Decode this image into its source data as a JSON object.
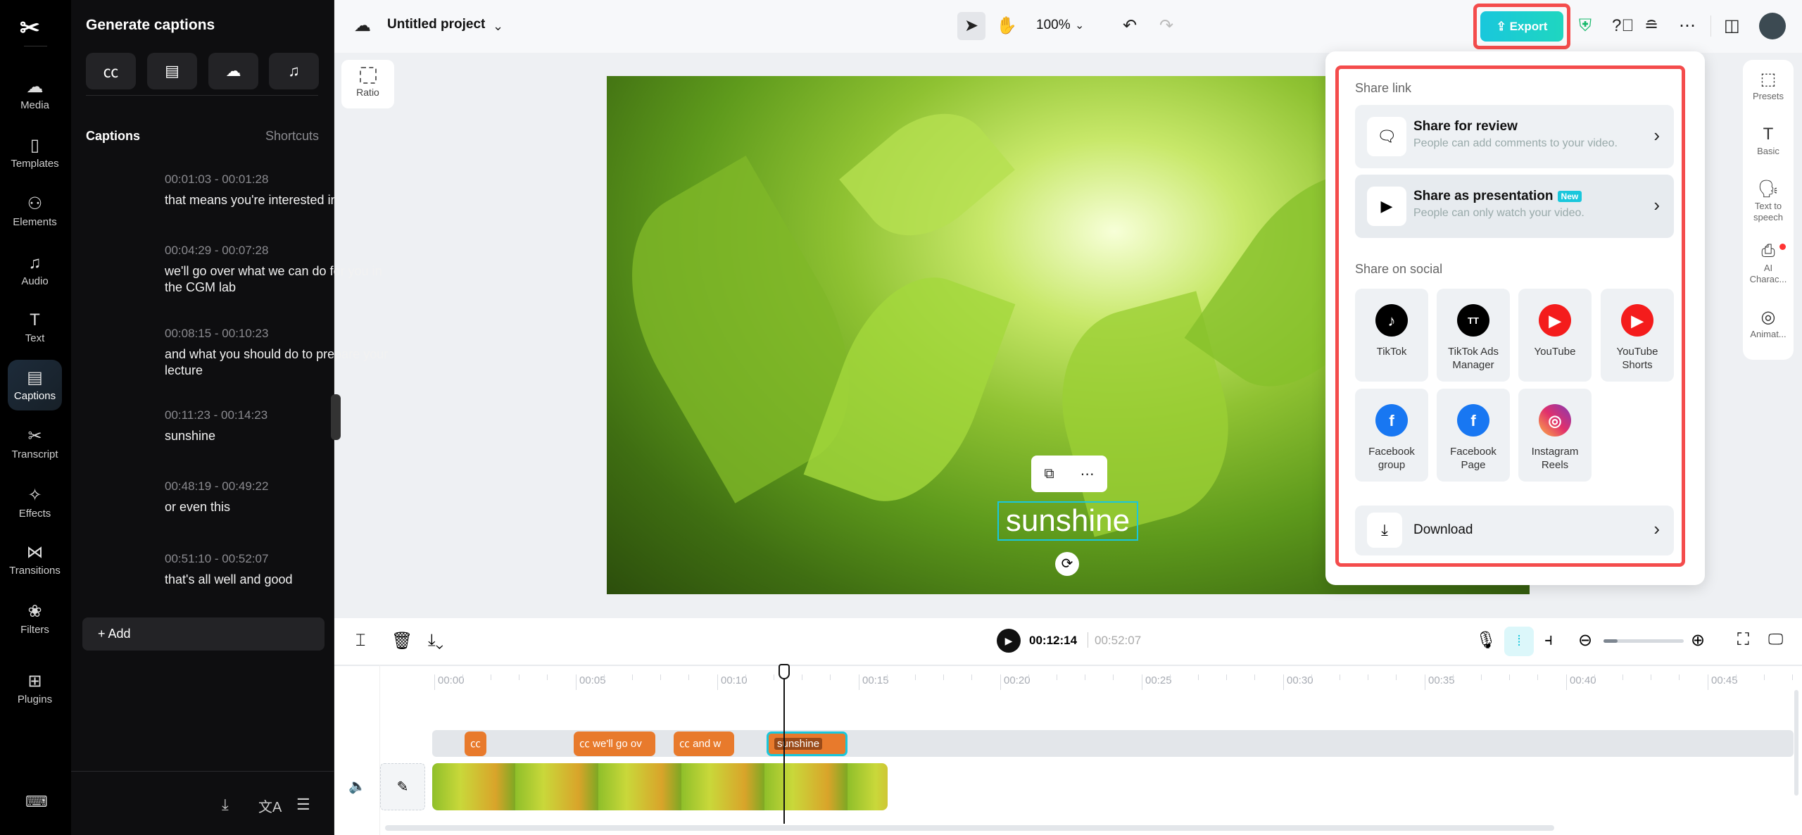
{
  "nav": {
    "items": [
      {
        "label": "Media",
        "icon": "cloud-upload-icon"
      },
      {
        "label": "Templates",
        "icon": "templates-icon"
      },
      {
        "label": "Elements",
        "icon": "elements-icon"
      },
      {
        "label": "Audio",
        "icon": "music-icon"
      },
      {
        "label": "Text",
        "icon": "text-icon"
      },
      {
        "label": "Captions",
        "icon": "captions-icon",
        "active": true
      },
      {
        "label": "Transcript",
        "icon": "transcript-icon"
      },
      {
        "label": "Effects",
        "icon": "effects-icon"
      },
      {
        "label": "Transitions",
        "icon": "transitions-icon"
      },
      {
        "label": "Filters",
        "icon": "filters-icon"
      },
      {
        "label": "Plugins",
        "icon": "plugins-icon"
      }
    ]
  },
  "captions_panel": {
    "title": "Generate captions",
    "section": "Captions",
    "shortcuts": "Shortcuts",
    "add": "+ Add",
    "items": [
      {
        "time": "00:01:03 - 00:01:28",
        "text": "that means you're interested in"
      },
      {
        "time": "00:04:29 - 00:07:28",
        "text": "we'll go over what we can do for you in the CGM lab"
      },
      {
        "time": "00:08:15 - 00:10:23",
        "text": "and what you should do to prepare your lecture"
      },
      {
        "time": "00:11:23 - 00:14:23",
        "text": "sunshine"
      },
      {
        "time": "00:48:19 - 00:49:22",
        "text": "or even this"
      },
      {
        "time": "00:51:10 - 00:52:07",
        "text": "that's all well and good"
      }
    ]
  },
  "topbar": {
    "project": "Untitled project",
    "zoom": "100%",
    "export": "Export"
  },
  "canvas": {
    "ratio": "Ratio",
    "caption_text": "sunshine"
  },
  "export_menu": {
    "share_link": "Share link",
    "share_review": {
      "title": "Share for review",
      "sub": "People can add comments to your video."
    },
    "share_presentation": {
      "title": "Share as presentation",
      "badge": "New",
      "sub": "People can only watch your video."
    },
    "share_social": "Share on social",
    "tiles": [
      {
        "label": "TikTok",
        "color": "#000000"
      },
      {
        "label": "TikTok Ads Manager",
        "color": "#000000"
      },
      {
        "label": "YouTube",
        "color": "#f41c1c"
      },
      {
        "label": "YouTube Shorts",
        "color": "#f41c1c"
      },
      {
        "label": "Facebook group",
        "color": "#1877f2"
      },
      {
        "label": "Facebook Page",
        "color": "#1877f2"
      },
      {
        "label": "Instagram Reels",
        "color": "#e1306c"
      }
    ],
    "download": "Download"
  },
  "right_panel": [
    {
      "label": "Presets"
    },
    {
      "label": "Basic"
    },
    {
      "label": "Text to speech"
    },
    {
      "label": "AI Charac..."
    },
    {
      "label": "Animat..."
    }
  ],
  "timeline": {
    "current": "00:12:14",
    "total": "00:52:07",
    "ticks": [
      "00:00",
      "00:05",
      "00:10",
      "00:15",
      "00:20",
      "00:25",
      "00:30",
      "00:35",
      "00:40",
      "00:45"
    ],
    "clips": [
      {
        "label": ""
      },
      {
        "label": "we'll go ov"
      },
      {
        "label": "and w"
      },
      {
        "label": "sunshine"
      }
    ]
  },
  "colors": {
    "accent": "#19c7dc",
    "highlight": "#f44c4c",
    "clip": "#e87a2c"
  }
}
